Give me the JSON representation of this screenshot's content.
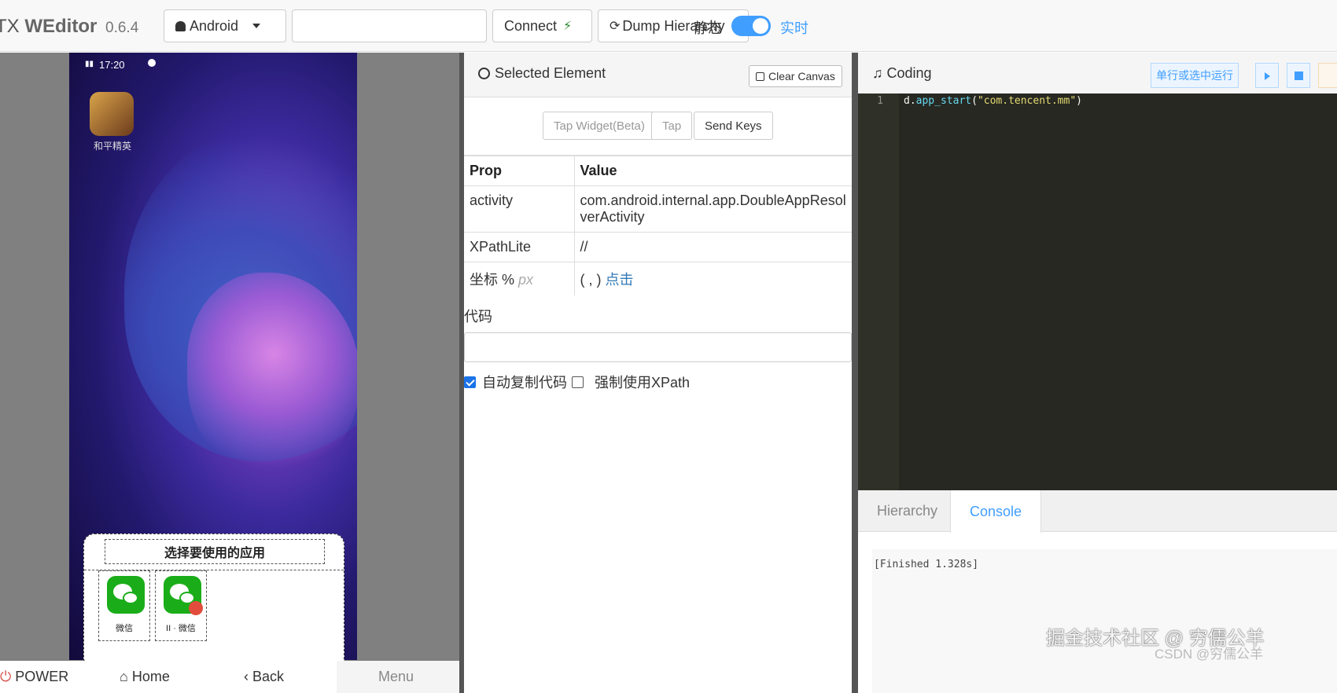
{
  "header": {
    "brand_prefix": "TX",
    "brand_name": "WEditor",
    "version": "0.6.4",
    "platform_select": "Android",
    "device_input_value": "",
    "connect_label": "Connect",
    "dump_label": "Dump Hierarchy",
    "static_label": "静态",
    "live_label": "实时",
    "live_mode_on": true
  },
  "device": {
    "status_time": "17:20",
    "home_app_label": "和平精英",
    "dialog_title": "选择要使用的应用",
    "dialog_apps": [
      "微信",
      "II · 微信"
    ]
  },
  "device_nav": {
    "power": "POWER",
    "home": "Home",
    "back": "Back",
    "menu": "Menu"
  },
  "inspector": {
    "title": "Selected Element",
    "clear_canvas": "Clear Canvas",
    "buttons": [
      "Tap Widget(Beta)",
      "Tap",
      "Send Keys"
    ],
    "table_headers": [
      "Prop",
      "Value"
    ],
    "rows": [
      {
        "prop": "activity",
        "value": "com.android.internal.app.DoubleAppResolverActivity"
      },
      {
        "prop": "XPathLite",
        "value": "//"
      },
      {
        "prop": "坐标 %",
        "prop_unit": "px",
        "value": "( , )",
        "value_link": "点击"
      }
    ],
    "code_label": "代码",
    "code_value": "",
    "auto_copy_label": "自动复制代码",
    "force_xpath_label": "强制使用XPath",
    "auto_copy_checked": true,
    "force_xpath_checked": false
  },
  "coding": {
    "title": "Coding",
    "run_label": "单行或选中运行",
    "line_number": "1",
    "code_obj": "d.",
    "code_fn": "app_start",
    "code_open": "(",
    "code_str": "\"com.tencent.mm\"",
    "code_close": ")",
    "tabs": [
      "Hierarchy",
      "Console"
    ],
    "active_tab": "Console",
    "console_output": "[Finished 1.328s]"
  },
  "watermark": {
    "main": "掘金技术社区 @ 穷儒公羊",
    "sub": "CSDN @穷儒公羊"
  },
  "colors": {
    "accent": "#409eff",
    "editor_bg": "#272822",
    "wechat_green": "#1aad19"
  }
}
